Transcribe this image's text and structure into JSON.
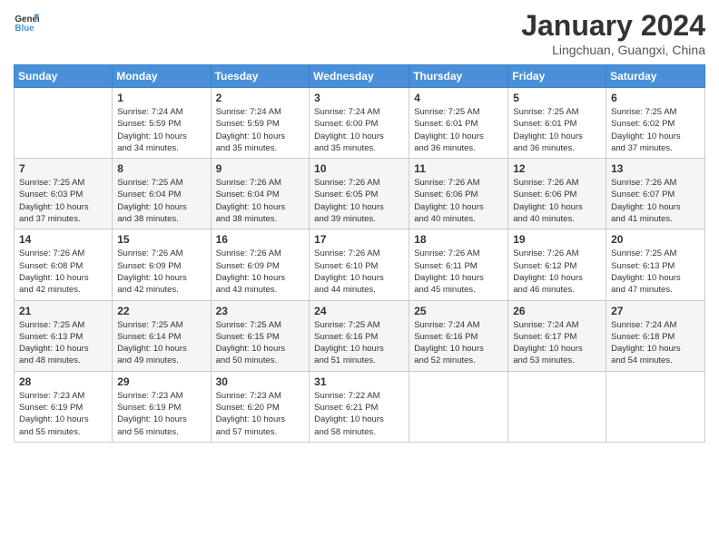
{
  "header": {
    "logo_line1": "General",
    "logo_line2": "Blue",
    "month": "January 2024",
    "location": "Lingchuan, Guangxi, China"
  },
  "weekdays": [
    "Sunday",
    "Monday",
    "Tuesday",
    "Wednesday",
    "Thursday",
    "Friday",
    "Saturday"
  ],
  "weeks": [
    [
      {
        "day": "",
        "info": ""
      },
      {
        "day": "1",
        "info": "Sunrise: 7:24 AM\nSunset: 5:59 PM\nDaylight: 10 hours\nand 34 minutes."
      },
      {
        "day": "2",
        "info": "Sunrise: 7:24 AM\nSunset: 5:59 PM\nDaylight: 10 hours\nand 35 minutes."
      },
      {
        "day": "3",
        "info": "Sunrise: 7:24 AM\nSunset: 6:00 PM\nDaylight: 10 hours\nand 35 minutes."
      },
      {
        "day": "4",
        "info": "Sunrise: 7:25 AM\nSunset: 6:01 PM\nDaylight: 10 hours\nand 36 minutes."
      },
      {
        "day": "5",
        "info": "Sunrise: 7:25 AM\nSunset: 6:01 PM\nDaylight: 10 hours\nand 36 minutes."
      },
      {
        "day": "6",
        "info": "Sunrise: 7:25 AM\nSunset: 6:02 PM\nDaylight: 10 hours\nand 37 minutes."
      }
    ],
    [
      {
        "day": "7",
        "info": "Sunrise: 7:25 AM\nSunset: 6:03 PM\nDaylight: 10 hours\nand 37 minutes."
      },
      {
        "day": "8",
        "info": "Sunrise: 7:25 AM\nSunset: 6:04 PM\nDaylight: 10 hours\nand 38 minutes."
      },
      {
        "day": "9",
        "info": "Sunrise: 7:26 AM\nSunset: 6:04 PM\nDaylight: 10 hours\nand 38 minutes."
      },
      {
        "day": "10",
        "info": "Sunrise: 7:26 AM\nSunset: 6:05 PM\nDaylight: 10 hours\nand 39 minutes."
      },
      {
        "day": "11",
        "info": "Sunrise: 7:26 AM\nSunset: 6:06 PM\nDaylight: 10 hours\nand 40 minutes."
      },
      {
        "day": "12",
        "info": "Sunrise: 7:26 AM\nSunset: 6:06 PM\nDaylight: 10 hours\nand 40 minutes."
      },
      {
        "day": "13",
        "info": "Sunrise: 7:26 AM\nSunset: 6:07 PM\nDaylight: 10 hours\nand 41 minutes."
      }
    ],
    [
      {
        "day": "14",
        "info": "Sunrise: 7:26 AM\nSunset: 6:08 PM\nDaylight: 10 hours\nand 42 minutes."
      },
      {
        "day": "15",
        "info": "Sunrise: 7:26 AM\nSunset: 6:09 PM\nDaylight: 10 hours\nand 42 minutes."
      },
      {
        "day": "16",
        "info": "Sunrise: 7:26 AM\nSunset: 6:09 PM\nDaylight: 10 hours\nand 43 minutes."
      },
      {
        "day": "17",
        "info": "Sunrise: 7:26 AM\nSunset: 6:10 PM\nDaylight: 10 hours\nand 44 minutes."
      },
      {
        "day": "18",
        "info": "Sunrise: 7:26 AM\nSunset: 6:11 PM\nDaylight: 10 hours\nand 45 minutes."
      },
      {
        "day": "19",
        "info": "Sunrise: 7:26 AM\nSunset: 6:12 PM\nDaylight: 10 hours\nand 46 minutes."
      },
      {
        "day": "20",
        "info": "Sunrise: 7:25 AM\nSunset: 6:13 PM\nDaylight: 10 hours\nand 47 minutes."
      }
    ],
    [
      {
        "day": "21",
        "info": "Sunrise: 7:25 AM\nSunset: 6:13 PM\nDaylight: 10 hours\nand 48 minutes."
      },
      {
        "day": "22",
        "info": "Sunrise: 7:25 AM\nSunset: 6:14 PM\nDaylight: 10 hours\nand 49 minutes."
      },
      {
        "day": "23",
        "info": "Sunrise: 7:25 AM\nSunset: 6:15 PM\nDaylight: 10 hours\nand 50 minutes."
      },
      {
        "day": "24",
        "info": "Sunrise: 7:25 AM\nSunset: 6:16 PM\nDaylight: 10 hours\nand 51 minutes."
      },
      {
        "day": "25",
        "info": "Sunrise: 7:24 AM\nSunset: 6:16 PM\nDaylight: 10 hours\nand 52 minutes."
      },
      {
        "day": "26",
        "info": "Sunrise: 7:24 AM\nSunset: 6:17 PM\nDaylight: 10 hours\nand 53 minutes."
      },
      {
        "day": "27",
        "info": "Sunrise: 7:24 AM\nSunset: 6:18 PM\nDaylight: 10 hours\nand 54 minutes."
      }
    ],
    [
      {
        "day": "28",
        "info": "Sunrise: 7:23 AM\nSunset: 6:19 PM\nDaylight: 10 hours\nand 55 minutes."
      },
      {
        "day": "29",
        "info": "Sunrise: 7:23 AM\nSunset: 6:19 PM\nDaylight: 10 hours\nand 56 minutes."
      },
      {
        "day": "30",
        "info": "Sunrise: 7:23 AM\nSunset: 6:20 PM\nDaylight: 10 hours\nand 57 minutes."
      },
      {
        "day": "31",
        "info": "Sunrise: 7:22 AM\nSunset: 6:21 PM\nDaylight: 10 hours\nand 58 minutes."
      },
      {
        "day": "",
        "info": ""
      },
      {
        "day": "",
        "info": ""
      },
      {
        "day": "",
        "info": ""
      }
    ]
  ]
}
